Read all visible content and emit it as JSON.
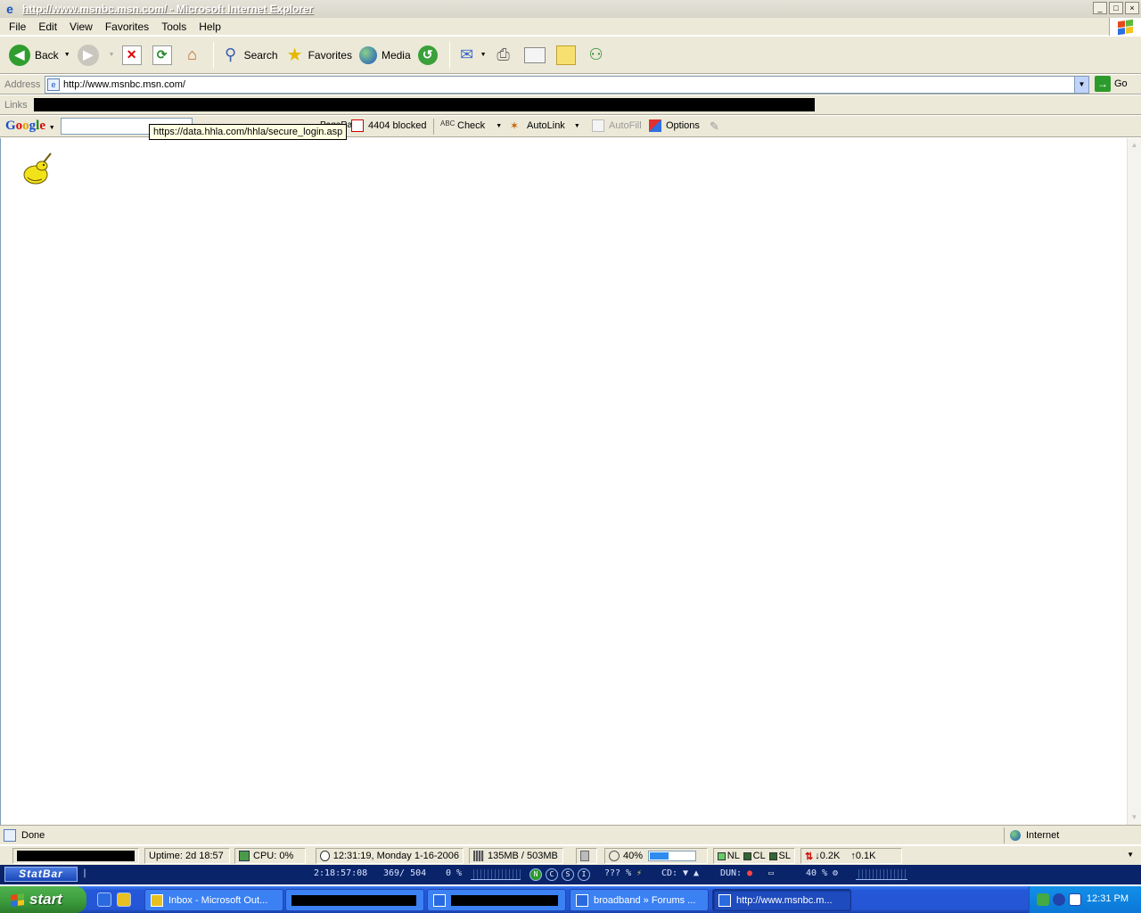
{
  "window": {
    "title": "http://www.msnbc.msn.com/ - Microsoft Internet Explorer",
    "controls": {
      "minimize": "_",
      "maximize": "□",
      "close": "×"
    }
  },
  "menu": [
    "File",
    "Edit",
    "View",
    "Favorites",
    "Tools",
    "Help"
  ],
  "toolbar": {
    "back": "Back",
    "search": "Search",
    "favorites": "Favorites",
    "media": "Media"
  },
  "address": {
    "label": "Address",
    "url": "http://www.msnbc.msn.com/",
    "go": "Go"
  },
  "links": {
    "label": "Links"
  },
  "google_toolbar": {
    "logo": [
      "G",
      "o",
      "o",
      "g",
      "l",
      "e"
    ],
    "search_value": "",
    "pagerank": "PageRank",
    "blocked": "4404 blocked",
    "check": "Check",
    "autolink": "AutoLink",
    "autofill": "AutoFill",
    "options": "Options"
  },
  "tooltip": "https://data.hhla.com/hhla/secure_login.asp",
  "status": {
    "text": "Done",
    "zone": "Internet"
  },
  "statbar": {
    "uptime": "Uptime: 2d 18:57",
    "cpu": "CPU: 0%",
    "datetime": "12:31:19, Monday 1-16-2006",
    "memory": "135MB / 503MB",
    "battery_percent": "40%",
    "battery_level": 0.4,
    "nl": "NL",
    "cl": "CL",
    "sl": "SL",
    "down": "0.2K",
    "up": "0.1K"
  },
  "statbar2": {
    "logo": "StatBar",
    "time": "2:18:57:08",
    "mem": "369/ 504",
    "cpu": "0 %",
    "leds": [
      "N",
      "C",
      "S",
      "I"
    ],
    "disk": "??? %",
    "cd": "CD:",
    "dun": "DUN:",
    "battery": "40 %"
  },
  "taskbar": {
    "start": "start",
    "tasks": [
      {
        "label": "Inbox - Microsoft Out..."
      },
      {
        "label": ""
      },
      {
        "label": ""
      },
      {
        "label": "broadband » Forums ..."
      },
      {
        "label": "http://www.msnbc.m..."
      }
    ],
    "clock": "12:31 PM"
  },
  "colors": {
    "chrome": "#ece9d8",
    "taskbar_blue": "#2458d8",
    "start_green": "#3a9a3a",
    "tooltip": "#ffffe1"
  }
}
